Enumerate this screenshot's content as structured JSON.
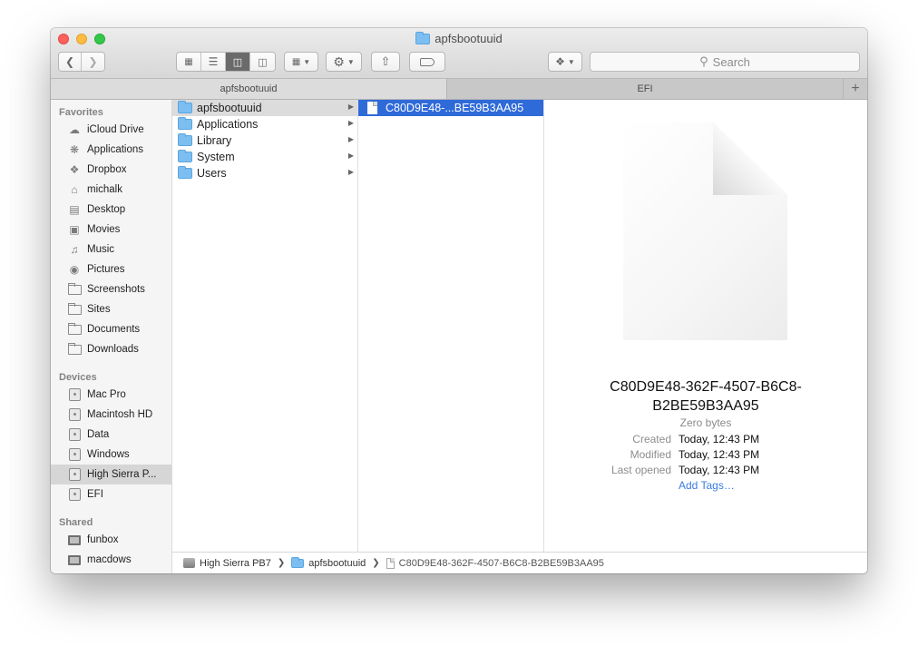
{
  "window": {
    "title": "apfsbootuuid"
  },
  "toolbar": {
    "back_icon": "chevron-left-icon",
    "forward_icon": "chevron-right-icon",
    "search_placeholder": "Search"
  },
  "tabs": [
    {
      "label": "apfsbootuuid",
      "active": true
    },
    {
      "label": "EFI",
      "active": false
    }
  ],
  "sidebar": {
    "favorites_header": "Favorites",
    "favorites": [
      {
        "label": "iCloud Drive",
        "icon": "cloud-icon"
      },
      {
        "label": "Applications",
        "icon": "applications-icon"
      },
      {
        "label": "Dropbox",
        "icon": "dropbox-icon"
      },
      {
        "label": "michalk",
        "icon": "home-icon"
      },
      {
        "label": "Desktop",
        "icon": "desktop-icon"
      },
      {
        "label": "Movies",
        "icon": "film-icon"
      },
      {
        "label": "Music",
        "icon": "music-icon"
      },
      {
        "label": "Pictures",
        "icon": "camera-icon"
      },
      {
        "label": "Screenshots",
        "icon": "folder-icon"
      },
      {
        "label": "Sites",
        "icon": "folder-icon"
      },
      {
        "label": "Documents",
        "icon": "folder-icon"
      },
      {
        "label": "Downloads",
        "icon": "folder-icon"
      }
    ],
    "devices_header": "Devices",
    "devices": [
      {
        "label": "Mac Pro",
        "icon": "mac-icon"
      },
      {
        "label": "Macintosh HD",
        "icon": "disk-icon"
      },
      {
        "label": "Data",
        "icon": "disk-icon"
      },
      {
        "label": "Windows",
        "icon": "disk-icon"
      },
      {
        "label": "High Sierra P...",
        "icon": "disk-icon",
        "selected": true
      },
      {
        "label": "EFI",
        "icon": "disk-icon"
      }
    ],
    "shared_header": "Shared",
    "shared": [
      {
        "label": "funbox",
        "icon": "monitor-icon"
      },
      {
        "label": "macdows",
        "icon": "monitor-icon"
      }
    ]
  },
  "columns": {
    "col1": [
      {
        "label": "apfsbootuuid",
        "highlighted": true
      },
      {
        "label": "Applications"
      },
      {
        "label": "Library"
      },
      {
        "label": "System"
      },
      {
        "label": "Users"
      }
    ],
    "col2": [
      {
        "label": "C80D9E48-...BE59B3AA95",
        "selected": true
      }
    ]
  },
  "preview": {
    "name_line1": "C80D9E48-362F-4507-B6C8-",
    "name_line2": "B2BE59B3AA95",
    "size": "Zero bytes",
    "created_label": "Created",
    "created_value": "Today, 12:43 PM",
    "modified_label": "Modified",
    "modified_value": "Today, 12:43 PM",
    "opened_label": "Last opened",
    "opened_value": "Today, 12:43 PM",
    "add_tags": "Add Tags…"
  },
  "pathbar": {
    "items": [
      "High Sierra PB7",
      "apfsbootuuid",
      "C80D9E48-362F-4507-B6C8-B2BE59B3AA95"
    ]
  }
}
